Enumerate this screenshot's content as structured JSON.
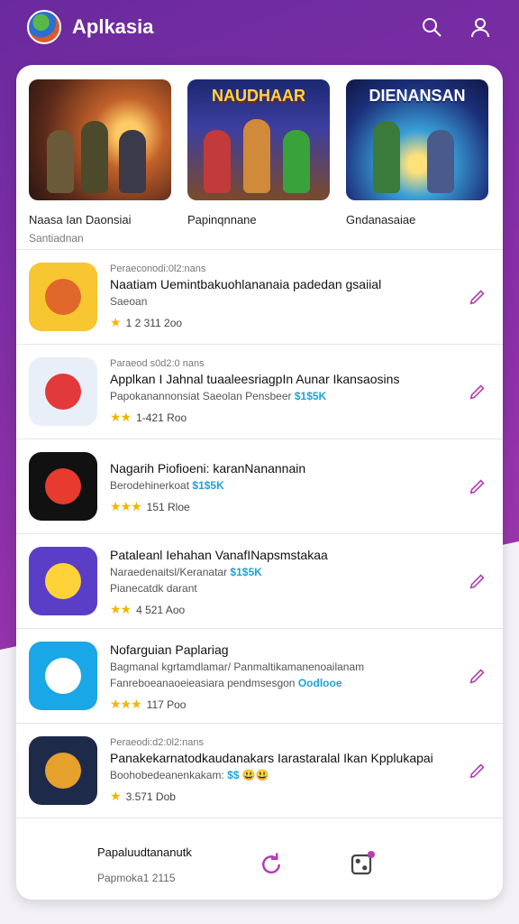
{
  "header": {
    "title": "Aplkasia",
    "search_icon": "search-icon",
    "profile_icon": "user-icon"
  },
  "featured": [
    {
      "banner": "",
      "name": "Naasa Ian Daonsiai",
      "sub": "Santiadnan"
    },
    {
      "banner": "NAUDHAAR",
      "name": "Papinqnnane",
      "sub": ""
    },
    {
      "banner": "DIENANSAN",
      "name": "Gndanasaiae",
      "sub": ""
    }
  ],
  "apps": [
    {
      "meta": "Peraeconodi:0l2:nans",
      "title": "Naatiam Uemintbakuohlananaia padedan gsaiial",
      "desc": "Saeoan",
      "price": "",
      "stars": "★",
      "rating": "1 2 311 2oo",
      "colors": [
        "#f7c631",
        "#e0672a"
      ]
    },
    {
      "meta": "Paraeod s0d2:0 nans",
      "title": "Applkan I Jahnal tuaaleesriagpIn Aunar Ikansaosins",
      "desc": "Papokanannonsiat Saeolan Pensbeer",
      "price": "$1$5K",
      "stars": "★★",
      "rating": "1-421 Roo",
      "colors": [
        "#e9eff8",
        "#e23a3a"
      ]
    },
    {
      "meta": "",
      "title": "Nagarih Piofioeni: karanNanannain",
      "desc": "Berodehinerkoat",
      "price": "$1$5K",
      "stars": "★★★",
      "rating": "151 Rloe",
      "colors": [
        "#111111",
        "#e63b2e"
      ]
    },
    {
      "meta": "",
      "title": "Pataleanl Iehahan VanafINapsmstakaa",
      "desc": "Naraedenaitsl/Keranatar",
      "price": "$1$5K",
      "desc2": "Pianecatdk darant",
      "stars": "★★",
      "rating": "4 521 Aoo",
      "colors": [
        "#5a3ec8",
        "#ffd23a"
      ]
    },
    {
      "meta": "",
      "title": "Nofarguian Paplariag",
      "desc": "Bagmanal kgrtamdlamar/ Panmaltikamanenoailanam",
      "price": "",
      "desc2": "Fanreboeanaoeieasiara pendmsesgon",
      "price2": "Oodlooe",
      "stars": "★★★",
      "rating": "117 Poo",
      "colors": [
        "#1aa7e8",
        "#ffffff"
      ]
    },
    {
      "meta": "Peraeodi:d2:0l2:nans",
      "title": "Panakekarnatodkaudanakars Iarastaralal Ikan Kpplukapai",
      "desc": "Boohobedeanenkakam:",
      "price": "$$ 😃😃",
      "stars": "★",
      "rating": "3.571 Dob",
      "colors": [
        "#1d2a4a",
        "#e6a02c"
      ]
    }
  ],
  "bottom": {
    "title": "Papaluudtananutk",
    "sub": "Papmoka1 2115",
    "nav1_icon": "refresh-icon",
    "nav2_icon": "dice-icon"
  },
  "colors": {
    "accent": "#b23fb3",
    "purple": "#6a2a9e",
    "price": "#1fa3d8",
    "star": "#f2b600"
  }
}
